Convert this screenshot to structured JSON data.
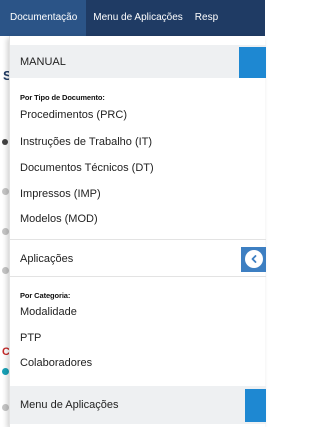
{
  "topnav": {
    "tabs": [
      {
        "label": "Documentação"
      },
      {
        "label": "Menu de Aplicações"
      },
      {
        "label": "Resp"
      }
    ]
  },
  "dropdown": {
    "manual_header": "MANUAL",
    "doc_group_label": "Por Tipo de Documento:",
    "doc_links": [
      "Procedimentos (PRC)",
      "Instruções de Trabalho (IT)",
      "Documentos Técnicos (DT)",
      "Impressos (IMP)",
      "Modelos (MOD)"
    ],
    "apps_header": "Aplicações",
    "category_group_label": "Por Categoria:",
    "category_links": [
      "Modalidade",
      "PTP",
      "Colaboradores"
    ],
    "menu_apps_header": "Menu de Aplicações"
  },
  "background": {
    "letter": "S",
    "mark": "C"
  },
  "icons": {
    "chevron": "chevron-left-icon"
  },
  "colors": {
    "nav_bg": "#1f3b64",
    "nav_active": "#2b5487",
    "accent_blue": "#1e88d2",
    "header_gray": "#eef0f2"
  }
}
